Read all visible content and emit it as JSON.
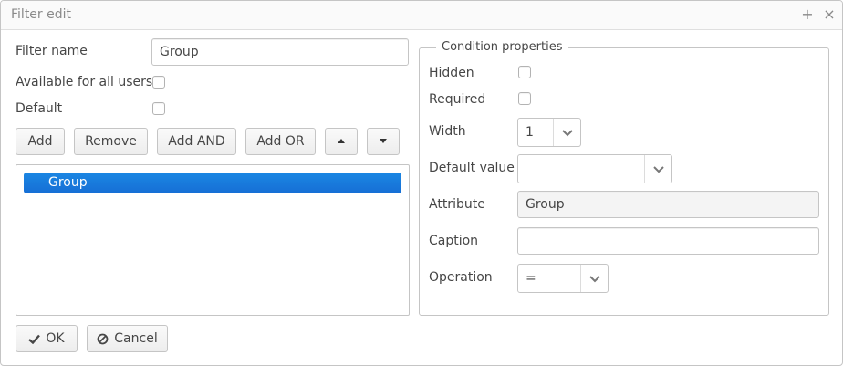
{
  "window": {
    "title": "Filter edit",
    "maximize_glyph": "+",
    "close_glyph": "×"
  },
  "form": {
    "filter_name_label": "Filter name",
    "filter_name_value": "Group",
    "available_all_users_label": "Available for all users",
    "available_all_users_checked": false,
    "default_label": "Default",
    "default_checked": false
  },
  "toolbar": {
    "add_label": "Add",
    "remove_label": "Remove",
    "add_and_label": "Add AND",
    "add_or_label": "Add OR",
    "move_up_icon": "triangle-up-icon",
    "move_down_icon": "triangle-down-icon"
  },
  "conditions_tree": {
    "items": [
      {
        "label": "Group",
        "selected": true
      }
    ]
  },
  "condition_properties": {
    "legend": "Condition properties",
    "hidden_label": "Hidden",
    "hidden_checked": false,
    "required_label": "Required",
    "required_checked": false,
    "width_label": "Width",
    "width_value": "1",
    "default_value_label": "Default value",
    "default_value": "",
    "attribute_label": "Attribute",
    "attribute_value": "Group",
    "caption_label": "Caption",
    "caption_value": "",
    "operation_label": "Operation",
    "operation_value": "="
  },
  "footer": {
    "ok_label": "OK",
    "ok_icon": "check-icon",
    "cancel_label": "Cancel",
    "cancel_icon": "ban-icon"
  },
  "colors": {
    "selection": "#197de1",
    "border": "#c5c5c5",
    "text": "#464646"
  }
}
